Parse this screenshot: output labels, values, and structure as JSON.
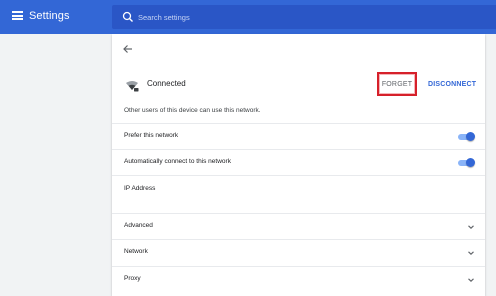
{
  "header": {
    "title": "Settings",
    "search_placeholder": "Search settings",
    "menu_icon": "hamburger-menu-icon",
    "search_icon": "search-icon",
    "background_color": "#3367d6"
  },
  "network_detail": {
    "back_icon": "back-arrow-icon",
    "wifi_icon": "wifi-signal-icon",
    "status": "Connected",
    "forget_label": "FORGET",
    "disconnect_label": "DISCONNECT",
    "shared_notice": "Other users of this device can use this network.",
    "prefer_network": {
      "label": "Prefer this network",
      "enabled": true
    },
    "auto_connect": {
      "label": "Automatically connect to this network",
      "enabled": true
    },
    "ip_address_label": "IP Address",
    "sections": [
      {
        "label": "Advanced",
        "expanded": false
      },
      {
        "label": "Network",
        "expanded": false
      },
      {
        "label": "Proxy",
        "expanded": false
      }
    ],
    "accent_color": "#3367d6",
    "highlight_color": "#d6202a"
  }
}
